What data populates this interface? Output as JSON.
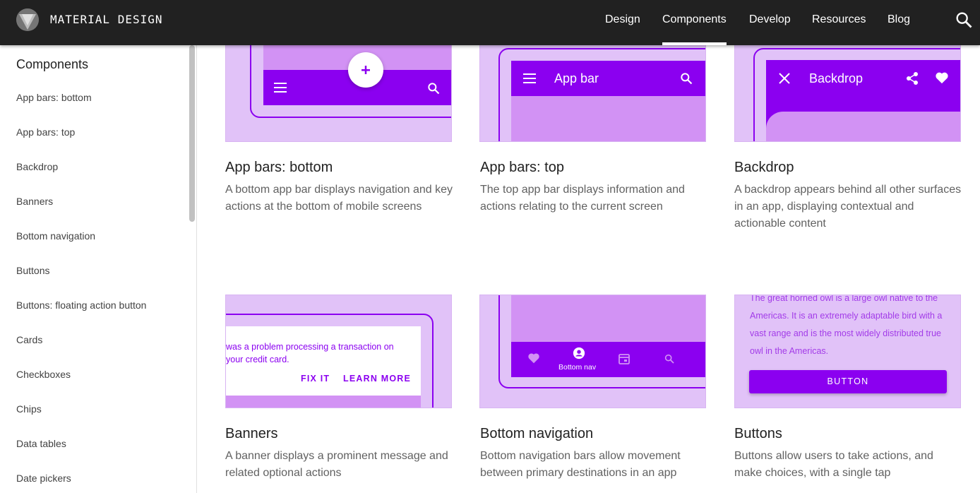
{
  "header": {
    "brand": "MATERIAL DESIGN",
    "nav": [
      "Design",
      "Components",
      "Develop",
      "Resources",
      "Blog"
    ],
    "active_nav": "Components"
  },
  "sidebar": {
    "title": "Components",
    "items": [
      "App bars: bottom",
      "App bars: top",
      "Backdrop",
      "Banners",
      "Bottom navigation",
      "Buttons",
      "Buttons: floating action button",
      "Cards",
      "Checkboxes",
      "Chips",
      "Data tables",
      "Date pickers"
    ]
  },
  "cards": [
    {
      "title": "App bars: bottom",
      "desc": "A bottom app bar displays navigation and key actions at the bottom of mobile screens"
    },
    {
      "title": "App bars: top",
      "desc": "The top app bar displays information and actions relating to the current screen"
    },
    {
      "title": "Backdrop",
      "desc": "A backdrop appears behind all other surfaces in an app, displaying contextual and actionable content"
    },
    {
      "title": "Banners",
      "desc": "A banner displays a prominent message and related optional actions"
    },
    {
      "title": "Bottom navigation",
      "desc": "Bottom navigation bars allow movement between primary destinations in an app"
    },
    {
      "title": "Buttons",
      "desc": "Buttons allow users to take actions, and make choices, with a single tap"
    }
  ],
  "illustrations": {
    "appbar_top_label": "App bar",
    "backdrop_label": "Backdrop",
    "banner_text": "was a problem processing a transaction on your credit card.",
    "banner_fix": "FIX IT",
    "banner_learn": "LEARN MORE",
    "bottom_nav_label": "Bottom nav",
    "buttons_text": "The great horned owl is a large owl native to the Americas. It is an extremely adaptable bird with a vast range and is the most widely distributed true owl in the Americas.",
    "buttons_label": "BUTTON"
  },
  "colors": {
    "accent": "#8b00f0",
    "surface": "#e1c2f8",
    "mid": "#d292f4",
    "topbar": "#212121"
  }
}
